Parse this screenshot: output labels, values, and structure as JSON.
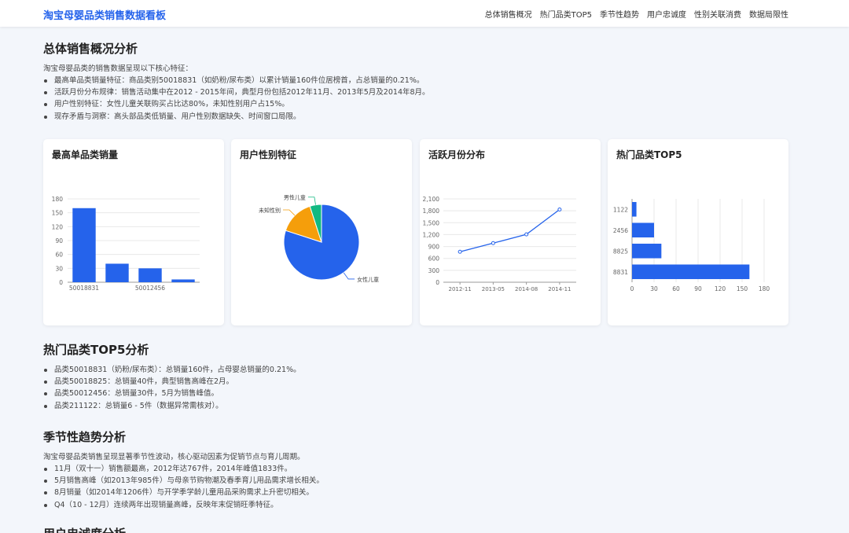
{
  "header": {
    "brand": "淘宝母婴品类销售数据看板",
    "nav": [
      "总体销售概况",
      "热门品类TOP5",
      "季节性趋势",
      "用户忠诚度",
      "性别关联消费",
      "数据局限性"
    ]
  },
  "overview": {
    "title": "总体销售概况分析",
    "intro": "淘宝母婴品类的销售数据呈现以下核心特征：",
    "bullets": [
      "最高单品类销量特征：商品类别50018831（如奶粉/尿布类）以累计销量160件位居榜首，占总销量的0.21%。",
      "活跃月份分布规律：销售活动集中在2012 - 2015年间，典型月份包括2012年11月、2013年5月及2014年8月。",
      "用户性别特征：女性儿童关联购买占比达80%，未知性别用户占15%。",
      "现存矛盾与洞察：高头部品类低销量、用户性别数据缺失、时间窗口局限。"
    ]
  },
  "cards": {
    "top_category_title": "最高单品类销量",
    "gender_title": "用户性别特征",
    "month_title": "活跃月份分布",
    "top5_title": "热门品类TOP5"
  },
  "chart_data": [
    {
      "type": "bar",
      "title": "最高单品类销量",
      "categories": [
        "50018831",
        "50018825",
        "50012456",
        "211122"
      ],
      "tick_labels_shown": [
        "50018831",
        "",
        "50012456",
        ""
      ],
      "values": [
        160,
        40,
        30,
        6
      ],
      "ylim": [
        0,
        180
      ],
      "yticks": [
        0,
        30,
        60,
        90,
        120,
        150,
        180
      ],
      "grid": true,
      "color": "#2563eb"
    },
    {
      "type": "pie",
      "title": "用户性别特征",
      "labels": [
        "女性儿童",
        "未知性别",
        "男性儿童"
      ],
      "values": [
        80,
        15,
        5
      ],
      "colors": [
        "#2563eb",
        "#f59e0b",
        "#10b981"
      ]
    },
    {
      "type": "line",
      "title": "活跃月份分布",
      "x": [
        "2012-11",
        "2013-05",
        "2014-08",
        "2014-11"
      ],
      "values": [
        767,
        985,
        1206,
        1833
      ],
      "ylim": [
        0,
        2100
      ],
      "ytick_labels": [
        "0",
        "300",
        "600",
        "900",
        "1,200",
        "1,500",
        "1,800",
        "2,100"
      ],
      "grid": true,
      "color": "#2563eb"
    },
    {
      "type": "bar",
      "orientation": "horizontal",
      "title": "热门品类TOP5",
      "categories": [
        "50018831",
        "50018825",
        "50012456",
        "211122"
      ],
      "tick_labels_shown": [
        "8831",
        "8825",
        "2456",
        "1122"
      ],
      "values": [
        160,
        40,
        30,
        6
      ],
      "xlim": [
        0,
        180
      ],
      "xticks": [
        0,
        30,
        60,
        90,
        120,
        150,
        180
      ],
      "grid": true,
      "color": "#2563eb"
    }
  ],
  "top5": {
    "title": "热门品类TOP5分析",
    "bullets": [
      "品类50018831（奶粉/尿布类）：总销量160件，占母婴总销量的0.21%。",
      "品类50018825：总销量40件，典型销售高峰在2月。",
      "品类50012456：总销量30件，5月为销售峰值。",
      "品类211122：总销量6 - 5件（数据异常需核对）。"
    ]
  },
  "seasonal": {
    "title": "季节性趋势分析",
    "intro": "淘宝母婴品类销售呈现显著季节性波动，核心驱动因素为促销节点与育儿周期。",
    "bullets": [
      "11月（双十一）销售额最高，2012年达767件，2014年峰值1833件。",
      "5月销售高峰（如2013年985件）与母亲节购物潮及春季育儿用品需求增长相关。",
      "8月销量（如2014年1206件）与开学季学龄儿童用品采购需求上升密切相关。",
      "Q4（10 - 12月）连续两年出现销量高峰，反映年末促销旺季特征。"
    ]
  },
  "loyalty": {
    "title": "用户忠诚度分析"
  }
}
